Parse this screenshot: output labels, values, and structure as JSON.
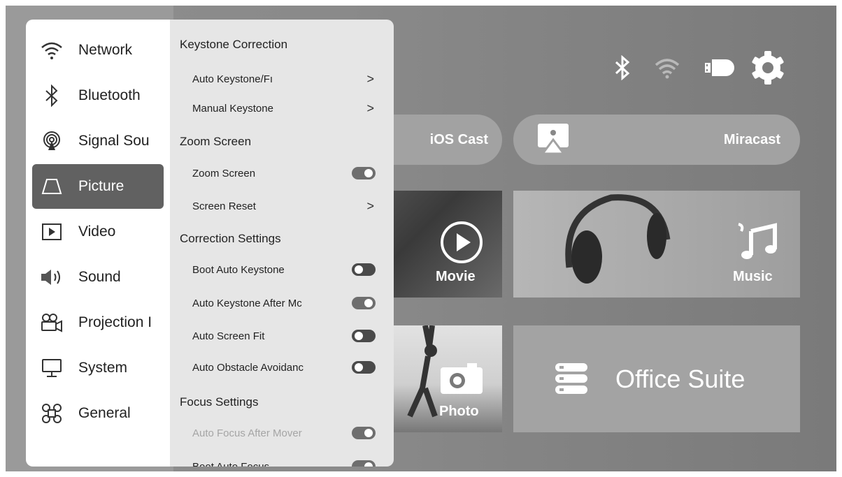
{
  "sidebar": {
    "items": [
      {
        "label": "Network",
        "icon": "wifi-icon"
      },
      {
        "label": "Bluetooth",
        "icon": "bluetooth-icon"
      },
      {
        "label": "Signal Sou",
        "icon": "signal-source-icon"
      },
      {
        "label": "Picture",
        "icon": "picture-icon",
        "active": true
      },
      {
        "label": "Video",
        "icon": "video-icon"
      },
      {
        "label": "Sound",
        "icon": "sound-icon"
      },
      {
        "label": "Projection I",
        "icon": "projection-icon"
      },
      {
        "label": "System",
        "icon": "system-icon"
      },
      {
        "label": "General",
        "icon": "general-icon"
      }
    ]
  },
  "panel": {
    "sections": {
      "keystone": "Keystone Correction",
      "zoom": "Zoom Screen",
      "correction": "Correction Settings",
      "focus": "Focus Settings"
    },
    "rows": {
      "auto_keystone": "Auto Keystone/Fı",
      "manual_keystone": "Manual Keystone",
      "zoom_screen": "Zoom Screen",
      "screen_reset": "Screen Reset",
      "boot_auto_keystone": "Boot Auto Keystone",
      "auto_keystone_after": "Auto Keystone After Mc",
      "auto_screen_fit": "Auto Screen Fit",
      "auto_obstacle": "Auto Obstacle Avoidanc",
      "auto_focus_after": "Auto Focus After Mover",
      "boot_auto_focus": "Boot Auto Focus"
    },
    "toggles": {
      "zoom_screen": "on",
      "boot_auto_keystone": "off",
      "auto_keystone_after": "on",
      "auto_screen_fit": "off",
      "auto_obstacle": "off",
      "auto_focus_after": "on",
      "boot_auto_focus": "on"
    }
  },
  "home": {
    "ios_cast": "iOS Cast",
    "miracast": "Miracast",
    "movie": "Movie",
    "music": "Music",
    "photo": "Photo",
    "office": "Office Suite"
  },
  "status_icons": [
    "bluetooth-icon",
    "wifi-icon",
    "usb-drive-icon",
    "settings-gear-icon"
  ]
}
